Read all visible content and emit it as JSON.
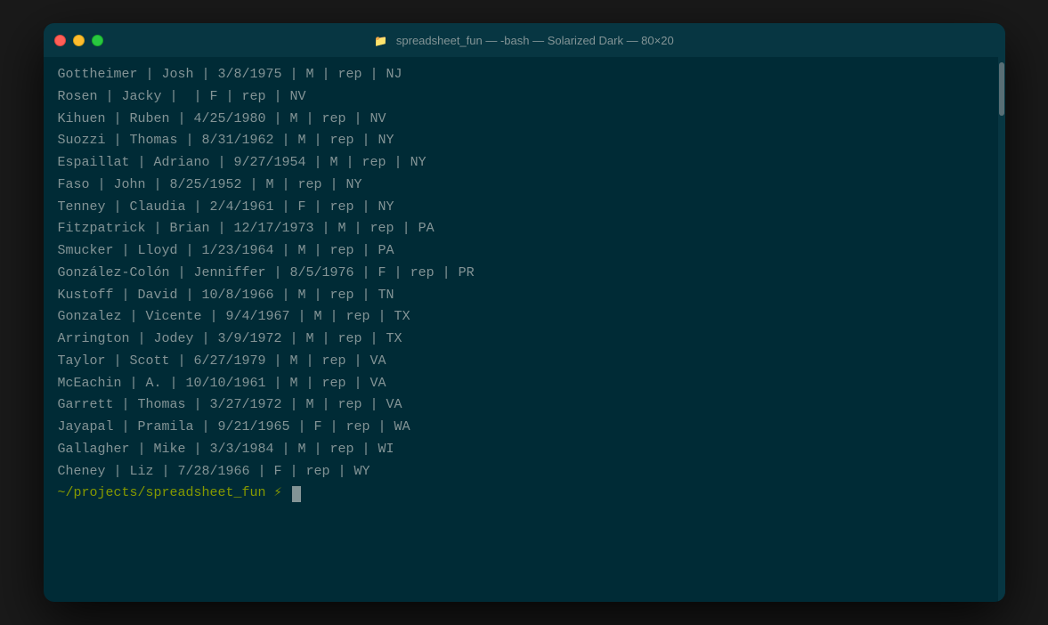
{
  "window": {
    "title": "spreadsheet_fun — -bash — Solarized Dark — 80×20",
    "traffic": {
      "close": "close",
      "minimize": "minimize",
      "maximize": "maximize"
    }
  },
  "terminal": {
    "lines": [
      "Gottheimer | Josh | 3/8/1975 | M | rep | NJ",
      "Rosen | Jacky |  | F | rep | NV",
      "Kihuen | Ruben | 4/25/1980 | M | rep | NV",
      "Suozzi | Thomas | 8/31/1962 | M | rep | NY",
      "Espaillat | Adriano | 9/27/1954 | M | rep | NY",
      "Faso | John | 8/25/1952 | M | rep | NY",
      "Tenney | Claudia | 2/4/1961 | F | rep | NY",
      "Fitzpatrick | Brian | 12/17/1973 | M | rep | PA",
      "Smucker | Lloyd | 1/23/1964 | M | rep | PA",
      "González-Colón | Jenniffer | 8/5/1976 | F | rep | PR",
      "Kustoff | David | 10/8/1966 | M | rep | TN",
      "Gonzalez | Vicente | 9/4/1967 | M | rep | TX",
      "Arrington | Jodey | 3/9/1972 | M | rep | TX",
      "Taylor | Scott | 6/27/1979 | M | rep | VA",
      "McEachin | A. | 10/10/1961 | M | rep | VA",
      "Garrett | Thomas | 3/27/1972 | M | rep | VA",
      "Jayapal | Pramila | 9/21/1965 | F | rep | WA",
      "Gallagher | Mike | 3/3/1984 | M | rep | WI",
      "Cheney | Liz | 7/28/1966 | F | rep | WY"
    ],
    "prompt": "~/projects/spreadsheet_fun ⚡ "
  }
}
